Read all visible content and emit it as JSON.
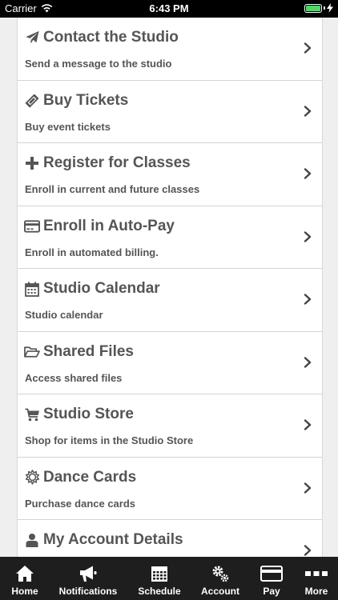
{
  "status_bar": {
    "carrier": "Carrier",
    "time": "6:43 PM",
    "battery_color": "#4cd964"
  },
  "menu": [
    {
      "title": "Contact the Studio",
      "subtitle": "Send a message to the studio",
      "icon": "paper-plane-icon"
    },
    {
      "title": "Buy Tickets",
      "subtitle": "Buy event tickets",
      "icon": "ticket-icon"
    },
    {
      "title": "Register for Classes",
      "subtitle": "Enroll in current and future classes",
      "icon": "plus-icon"
    },
    {
      "title": "Enroll in Auto-Pay",
      "subtitle": "Enroll in automated billing.",
      "icon": "credit-card-icon"
    },
    {
      "title": "Studio Calendar",
      "subtitle": "Studio calendar",
      "icon": "calendar-icon"
    },
    {
      "title": "Shared Files",
      "subtitle": "Access shared files",
      "icon": "folder-open-icon"
    },
    {
      "title": "Studio Store",
      "subtitle": "Shop for items in the Studio Store",
      "icon": "shopping-cart-icon"
    },
    {
      "title": "Dance Cards",
      "subtitle": "Purchase dance cards",
      "icon": "gear-icon"
    },
    {
      "title": "My Account Details",
      "subtitle": "",
      "icon": "user-icon"
    }
  ],
  "tabs": [
    {
      "label": "Home",
      "icon": "home-icon"
    },
    {
      "label": "Notifications",
      "icon": "megaphone-icon"
    },
    {
      "label": "Schedule",
      "icon": "calendar-grid-icon"
    },
    {
      "label": "Account",
      "icon": "gears-icon"
    },
    {
      "label": "Pay",
      "icon": "credit-card-icon"
    },
    {
      "label": "More",
      "icon": "more-icon"
    }
  ]
}
